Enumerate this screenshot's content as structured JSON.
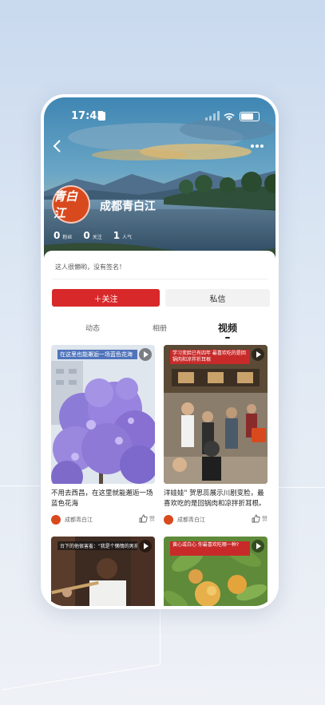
{
  "status_bar": {
    "time": "17:45"
  },
  "profile": {
    "avatar_text": "青白江",
    "name": "成都青白江",
    "stats": [
      {
        "value": "0",
        "label": "粉丝"
      },
      {
        "value": "0",
        "label": "关注"
      },
      {
        "value": "1",
        "label": "人气"
      }
    ],
    "signature": "这人很懒哟，没有签名！"
  },
  "actions": {
    "follow": "＋关注",
    "message": "私信"
  },
  "tabs": [
    {
      "label": "动态",
      "active": false
    },
    {
      "label": "相册",
      "active": false
    },
    {
      "label": "视频",
      "active": true
    }
  ],
  "videos": [
    {
      "caption": "在这里也能邂逅一场蓝色花海",
      "title": "不用去西昌，在这里就能邂逅一场蓝色花海",
      "author": "成都青白江",
      "like_label": "赞"
    },
    {
      "caption": "学习变脸已有四年 最喜欢吃的是回锅肉和凉拌折耳根",
      "title": "洋娃娃\" 贺思蕊展示川剧变脸，最喜欢吃的是回锅肉和凉拌折耳根。",
      "author": "成都青白江",
      "like_label": "赞"
    },
    {
      "caption": "台下的他很害羞：\"我是个懒惰的男孩子\"",
      "title": "",
      "author": "",
      "like_label": ""
    },
    {
      "caption": "黄心或白心  你最喜欢吃哪一种?",
      "title": "",
      "author": "",
      "like_label": ""
    }
  ]
}
